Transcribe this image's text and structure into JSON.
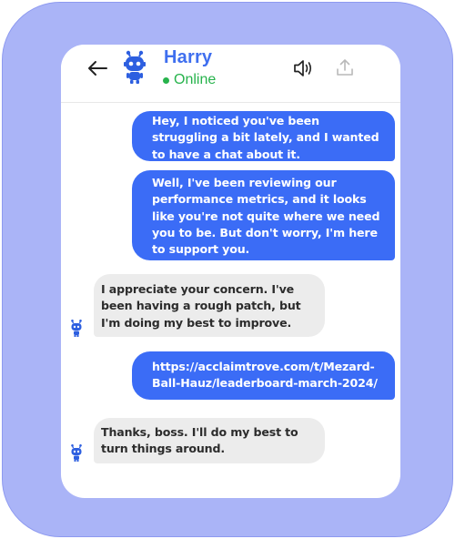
{
  "header": {
    "contact_name": "Harry",
    "status": "Online"
  },
  "icons": {
    "back": "arrow-left-icon",
    "avatar": "robot-icon",
    "speaker": "speaker-icon",
    "share": "share-upload-icon"
  },
  "colors": {
    "frame": "#aab4f7",
    "sent_bubble": "#3b6cf6",
    "received_bubble": "#ececec",
    "name": "#3f6fef",
    "online": "#27b34c"
  },
  "messages": [
    {
      "from": "sent",
      "text": "Hey, I noticed you've been struggling a bit lately, and I wanted to have a chat about it."
    },
    {
      "from": "sent",
      "text": "Well, I've been reviewing our performance metrics, and it looks like you're not quite where we need you to be. But don't worry, I'm here to support you."
    },
    {
      "from": "received",
      "text": "I appreciate your concern. I've been having a rough patch, but I'm doing my best to improve."
    },
    {
      "from": "sent",
      "text": "https://acclaimtrove.com/t/Mezard-Ball-Hauz/leaderboard-march-2024/"
    },
    {
      "from": "received",
      "text": "Thanks, boss. I'll do my best to turn things around."
    }
  ]
}
